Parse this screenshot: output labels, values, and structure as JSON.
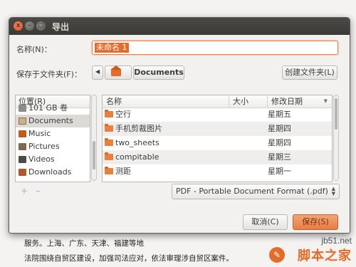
{
  "window": {
    "title": "导出",
    "close_glyph": "x",
    "min_glyph": "–",
    "max_glyph": "□"
  },
  "form": {
    "name_label": "名称(N)：",
    "name_value": "未命名 1",
    "folder_label": "保存于文件夹(F)：",
    "current_folder": "Documents",
    "create_folder_label": "创建文件夹(L)"
  },
  "places": {
    "header": "位置(R)",
    "items": [
      {
        "label": "101 GB 卷",
        "icon": "drive-icon"
      },
      {
        "label": "Documents",
        "icon": "documents-folder-icon"
      },
      {
        "label": "Music",
        "icon": "music-folder-icon"
      },
      {
        "label": "Pictures",
        "icon": "pictures-folder-icon"
      },
      {
        "label": "Videos",
        "icon": "videos-folder-icon"
      },
      {
        "label": "Downloads",
        "icon": "downloads-folder-icon"
      }
    ]
  },
  "files": {
    "columns": {
      "name": "名称",
      "size": "大小",
      "modified": "修改日期",
      "sort_icon": "▼"
    },
    "rows": [
      {
        "name": "空行",
        "size": "",
        "modified": "星期五"
      },
      {
        "name": "手机剪裁图片",
        "size": "",
        "modified": "星期四"
      },
      {
        "name": "two_sheets",
        "size": "",
        "modified": "星期四"
      },
      {
        "name": "compitable",
        "size": "",
        "modified": "星期三"
      },
      {
        "name": "测距",
        "size": "",
        "modified": "星期一"
      }
    ]
  },
  "bottom": {
    "add_glyph": "+",
    "remove_glyph": "–",
    "filter_value": "PDF - Portable Document Format (.pdf)",
    "cancel_label": "取消(C)",
    "save_label": "保存(S)"
  },
  "background_doc": {
    "line1": "服务。上海、广东、天津、福建等地",
    "line2": "法院围绕自贸区建设，加强司法应对，依法审理涉自贸区案件。"
  },
  "watermark": {
    "site": "jb51.net",
    "brand": "脚本之家",
    "icon_glyph": "✎"
  },
  "colors": {
    "accent": "#e46b2a",
    "titlebar": "#3c3b37",
    "selected_row": "#dcdad5"
  }
}
